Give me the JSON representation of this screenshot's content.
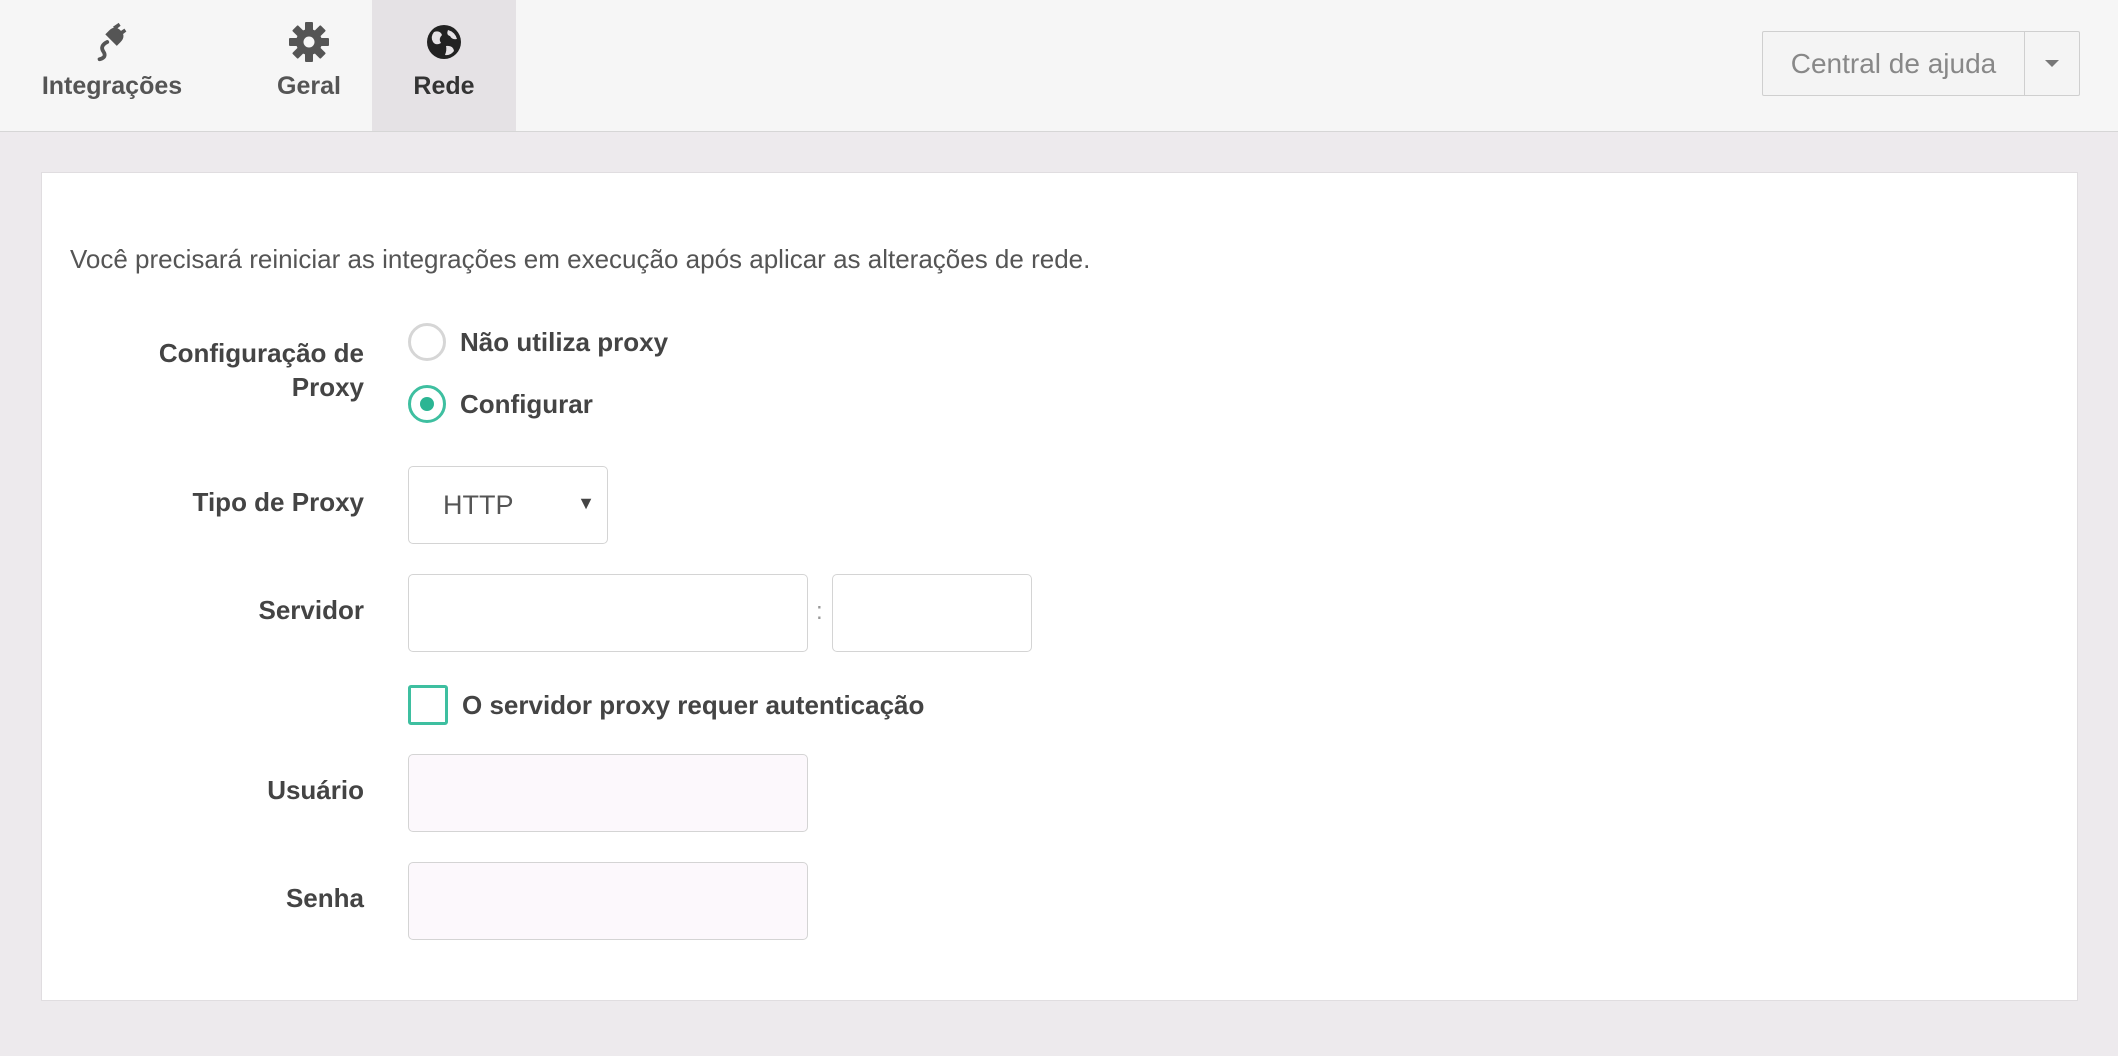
{
  "tabs": [
    {
      "label": "Integrações",
      "icon": "plug-icon",
      "active": false
    },
    {
      "label": "Geral",
      "icon": "gear-icon",
      "active": false
    },
    {
      "label": "Rede",
      "icon": "globe-icon",
      "active": true
    }
  ],
  "help": {
    "label": "Central de ajuda",
    "icon": "caret-down-icon"
  },
  "notice": "Você precisará reiniciar as integrações em execução após aplicar as alterações de rede.",
  "proxy_config": {
    "label_line1": "Configuração de",
    "label_line2": "Proxy",
    "options": [
      {
        "label": "Não utiliza proxy",
        "checked": false
      },
      {
        "label": "Configurar",
        "checked": true
      }
    ]
  },
  "proxy_type": {
    "label": "Tipo de Proxy",
    "value": "HTTP"
  },
  "server": {
    "label": "Servidor",
    "host_value": "",
    "port_value": "",
    "separator": ":"
  },
  "auth": {
    "label": "O servidor proxy requer autenticação",
    "checked": false
  },
  "user": {
    "label": "Usuário",
    "value": ""
  },
  "password": {
    "label": "Senha",
    "value": ""
  },
  "colors": {
    "accent": "#2bb593",
    "background": "#edeaed",
    "panel": "#ffffff"
  }
}
